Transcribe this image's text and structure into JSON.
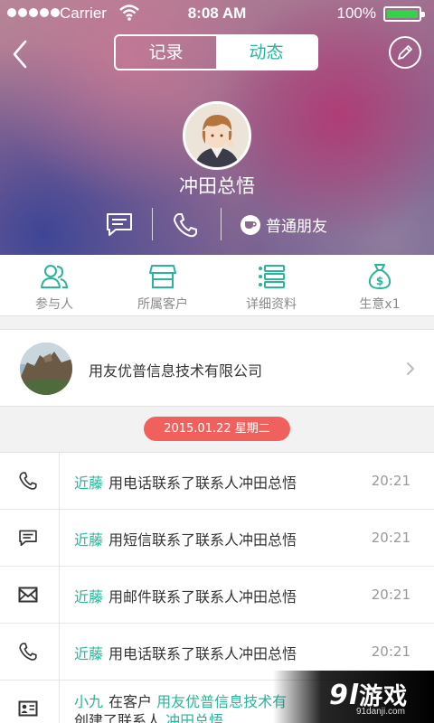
{
  "status_bar": {
    "carrier": "Carrier",
    "time": "8:08 AM",
    "battery": "100%",
    "battery_level": 1.0
  },
  "header": {
    "tabs": [
      {
        "label": "记录",
        "selected": false
      },
      {
        "label": "动态",
        "selected": true
      }
    ],
    "contact_name": "冲田总悟",
    "relation_label": "普通朋友",
    "icons": {
      "back": "back-chevron-icon",
      "edit": "pencil-icon",
      "message": "message-icon",
      "phone": "phone-icon",
      "relation": "coffee-cup-icon"
    }
  },
  "quick_nav": [
    {
      "label": "参与人",
      "icon": "people-icon"
    },
    {
      "label": "所属客户",
      "icon": "store-icon"
    },
    {
      "label": "详细资料",
      "icon": "list-icon"
    },
    {
      "label": "生意x1",
      "icon": "money-bag-icon"
    }
  ],
  "company": {
    "name": "用友优普信息技术有限公司",
    "icon": "chevron-right-icon"
  },
  "date_badge": "2015.01.22  星期二",
  "timeline": [
    {
      "icon": "phone-icon",
      "who": "近藤",
      "action": "用电话联系了联系人冲田总悟",
      "time": "20:21"
    },
    {
      "icon": "message-icon",
      "who": "近藤",
      "action": "用短信联系了联系人冲田总悟",
      "time": "20:21"
    },
    {
      "icon": "mail-icon",
      "who": "近藤",
      "action": "用邮件联系了联系人冲田总悟",
      "time": "20:21"
    },
    {
      "icon": "phone-icon",
      "who": "近藤",
      "action": "用电话联系了联系人冲田总悟",
      "time": "20:21"
    },
    {
      "icon": "contact-card-icon",
      "who": "小九",
      "part1": "在客户",
      "customer": "用友优普信息技术有",
      "part2": "创建了联系人",
      "contact": "冲田总悟"
    }
  ],
  "watermark": {
    "logo": "游戏",
    "logo_mark": "9l",
    "site": "91danji.com"
  },
  "colors": {
    "accent": "#2ab59a",
    "date_badge": "#f0615e"
  }
}
